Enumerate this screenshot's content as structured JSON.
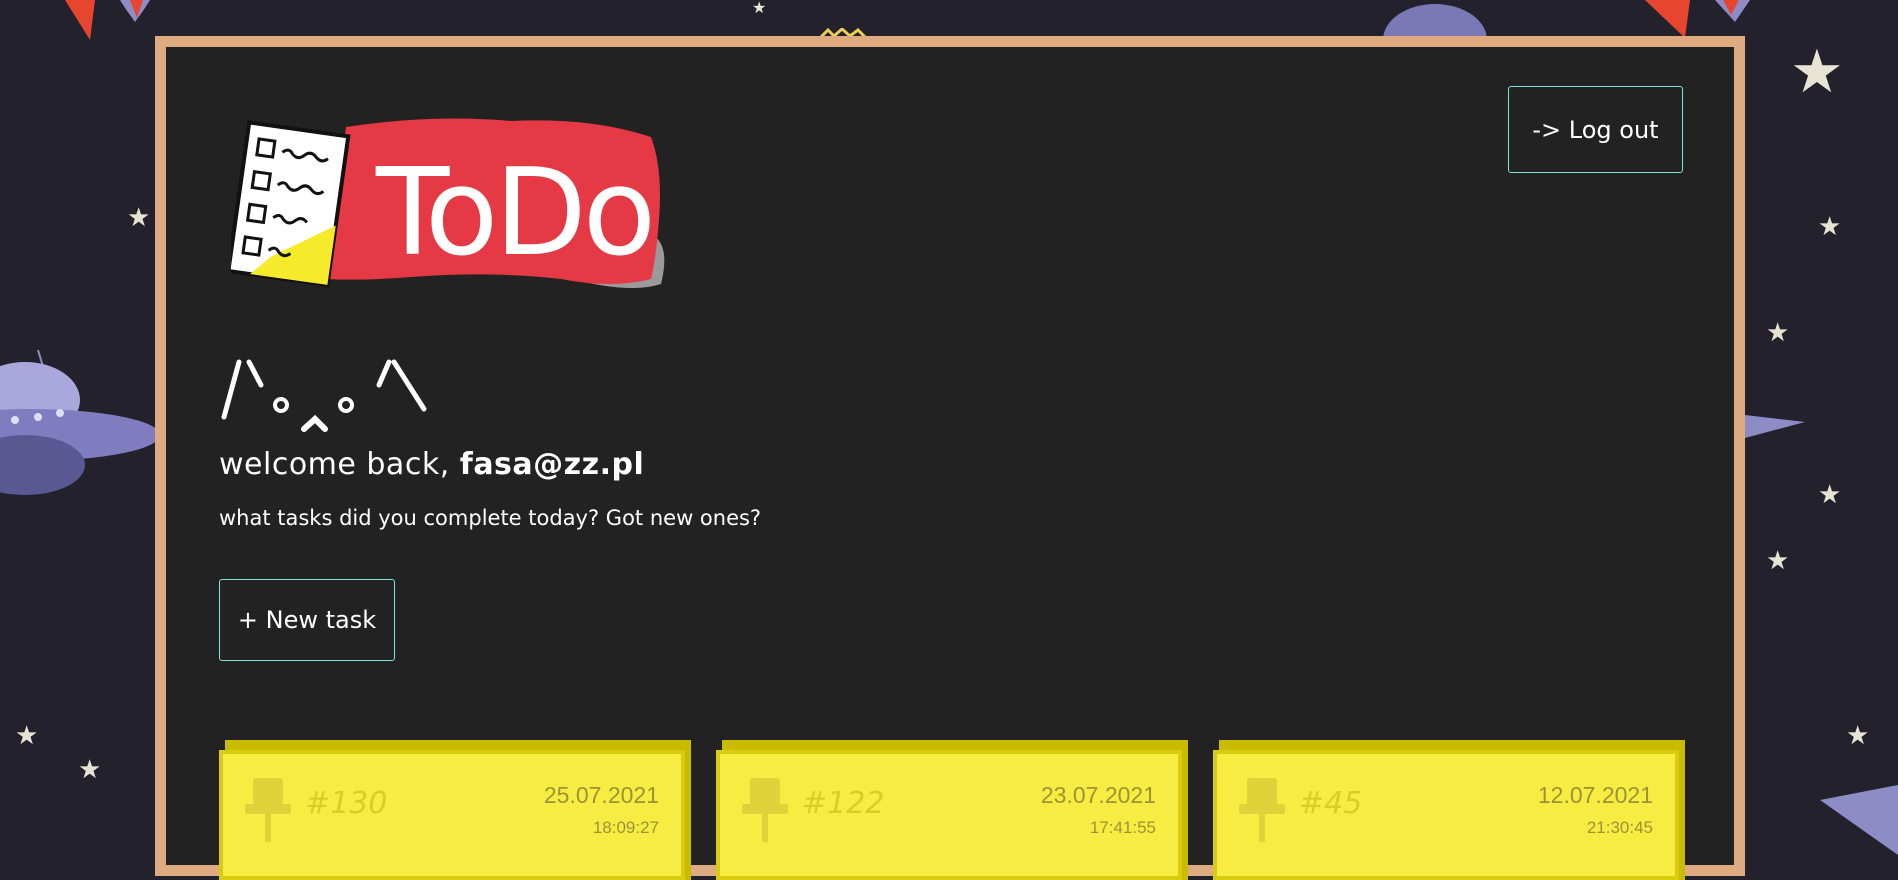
{
  "app": {
    "logo_text": "ToDo"
  },
  "header": {
    "logout_label": "-> Log out"
  },
  "greeting": {
    "cat_face": "/\\ₒ‸ₒ/\\",
    "welcome_prefix": "welcome back, ",
    "email": "fasa@zz.pl",
    "subtitle": "what tasks did you complete today? Got new ones?"
  },
  "actions": {
    "new_task_label": "+ New task"
  },
  "tasks": [
    {
      "id": "#130",
      "date": "25.07.2021",
      "time": "18:09:27"
    },
    {
      "id": "#122",
      "date": "23.07.2021",
      "time": "17:41:55"
    },
    {
      "id": "#45",
      "date": "12.07.2021",
      "time": "21:30:45"
    }
  ],
  "colors": {
    "background": "#22212c",
    "board": "#222222",
    "board_border": "#deaa80",
    "button_border": "#7fe4e0",
    "card": "#f7ec41",
    "logo_red": "#e63946"
  }
}
